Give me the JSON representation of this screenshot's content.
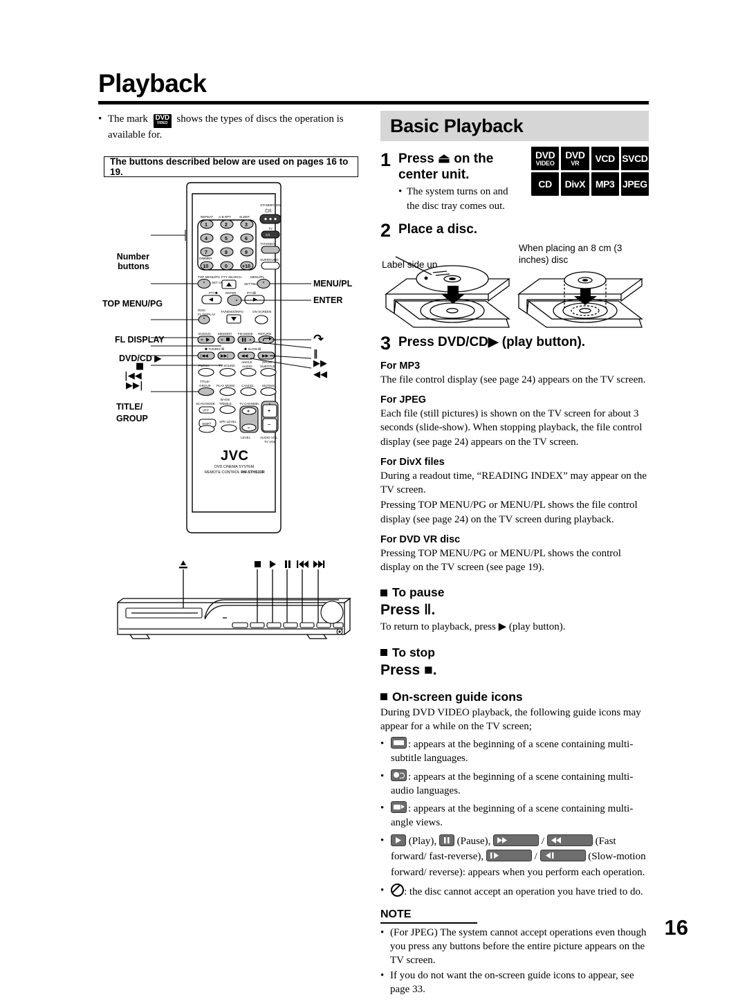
{
  "page": {
    "title": "Playback",
    "number": "16"
  },
  "left": {
    "mark_note_pre": "The mark",
    "mark_badge_line1": "DVD",
    "mark_badge_line2": "VIDEO",
    "mark_note_post": "shows the types of discs the operation is available for.",
    "buttons_note": "The buttons described below are used on pages 16 to 19.",
    "remote_labels_left": [
      "Number buttons",
      "TOP MENU/PG",
      "FL DISPLAY",
      "DVD/CD ▶",
      "■",
      "|◀◀",
      "▶▶|",
      "TITLE/ GROUP"
    ],
    "remote_labels_right": [
      "MENU/PL",
      "ENTER",
      "↷",
      "‖",
      "▶▶",
      "◀◀"
    ],
    "remote_keys": {
      "standby_label": "STANDBY/ON",
      "standby_sym": "⏻/I",
      "tv_label": "TV",
      "tv_sym": "⏻/I",
      "tv_video": "TV/VIDEO",
      "surround": "SURROUND",
      "num_row1": [
        "REPEAT",
        "A-B RPT",
        "SLEEP"
      ],
      "num_keys": [
        "1",
        "2",
        "3",
        "4",
        "5",
        "6",
        "7",
        "8",
        "9",
        "10",
        "0",
        "+10"
      ],
      "dimmer": "DIMMER",
      "top_menu_pg": "TOP MENU/PG",
      "set_up": "SET UP",
      "pty_search": "PTY SEARCH",
      "menu_pl": "MENU/PL",
      "setting": "SETTING",
      "pty_minus": "PTY",
      "enter": "ENTER",
      "pty_plus": "PTY",
      "rds_fl_display": "RDS/ FL DISPLAY",
      "ta_news_info": "TA/NEWS/INFO",
      "on_screen": "ON SCREEN",
      "dvd_cd": "DVD/CD",
      "memory": "MEMORY",
      "fm_mode": "FM MODE",
      "return": "RETURN",
      "tuning": "TUNING",
      "slow": "SLOW",
      "fm_am": "FM/AM",
      "tv_sound": "TV SOUND",
      "angle": "ANGLE",
      "audio": "AUDIO",
      "zoom": "ZOOM",
      "subtitle": "SUBTITLE",
      "title_group": "TITLE/ GROUP",
      "play_mode": "PLAY MODE",
      "cancel": "CANCEL",
      "muting": "MUTING",
      "scan_mode": "SCAN MODE",
      "vfp": "VFP",
      "bass_treble": "BASS/ TREBLE",
      "tv_channel": "TV CHANNEL",
      "shift": "SHIFT",
      "spk_level": "SPK-LEVEL",
      "level": "LEVEL",
      "audio_vol": "AUDIO VOL",
      "tv_vol": "TV VOL",
      "brand": "JVC",
      "brand_sub1": "DVD CINEMA SYSTEM",
      "brand_sub2": "REMOTE CONTROL",
      "model": "RM-STHS33R"
    },
    "center_unit_labels": [
      "▲",
      "■",
      "▶",
      "‖",
      "|◀◀",
      "▶▶|"
    ]
  },
  "right": {
    "section_title": "Basic Playback",
    "discs": [
      {
        "l1": "DVD",
        "l2": "VIDEO"
      },
      {
        "l1": "DVD",
        "l2": "VR"
      },
      {
        "l1": "VCD",
        "l2": ""
      },
      {
        "l1": "SVCD",
        "l2": ""
      },
      {
        "l1": "CD",
        "l2": ""
      },
      {
        "l1": "DivX",
        "l2": ""
      },
      {
        "l1": "MP3",
        "l2": ""
      },
      {
        "l1": "JPEG",
        "l2": ""
      }
    ],
    "step1": {
      "num": "1",
      "head": "Press ⏏ on the center unit.",
      "bullet": "The system turns on and the disc tray comes out."
    },
    "step2": {
      "num": "2",
      "head": "Place a disc.",
      "caption_left": "Label side up",
      "caption_right": "When placing an 8 cm (3 inches) disc"
    },
    "step3": {
      "num": "3",
      "head": "Press DVD/CD▶ (play button).",
      "blocks": [
        {
          "head": "For MP3",
          "body": "The file control display (see page 24) appears on the TV screen."
        },
        {
          "head": "For JPEG",
          "body": "Each file (still pictures) is shown on the TV screen for about 3 seconds (slide-show). When stopping playback, the file control display (see page 24) appears on the TV screen."
        },
        {
          "head": "For DivX files",
          "body": "During a readout time, “READING INDEX” may appear on the TV screen."
        },
        {
          "head": "",
          "body": "Pressing TOP MENU/PG or MENU/PL shows the file control display (see page 24) on the TV screen during playback."
        },
        {
          "head": "For DVD VR disc",
          "body": "Pressing TOP MENU/PG or MENU/PL shows the control display on the TV screen (see page 19)."
        }
      ]
    },
    "to_pause": {
      "head": "To pause",
      "press": "Press ‖.",
      "body": "To return to playback, press ▶ (play button)."
    },
    "to_stop": {
      "head": "To stop",
      "press": "Press ■."
    },
    "guide": {
      "head": "On-screen guide icons",
      "intro": "During DVD VIDEO playback, the following guide icons may appear for a while on the TV screen;",
      "items": [
        {
          "icon": "subtitle-icon",
          "text": ": appears at the beginning of a scene containing multi-subtitle languages."
        },
        {
          "icon": "audio-icon",
          "text": ": appears at the beginning of a scene containing multi-audio languages."
        },
        {
          "icon": "angle-icon",
          "text": ": appears at the beginning of a scene containing multi-angle views."
        }
      ],
      "transport_labels": {
        "play": "(Play),",
        "pause": "(Pause),",
        "slash": "/",
        "ff_fr": "(Fast forward/ fast-reverse),",
        "slow": "(Slow-motion forward/ reverse): appears when you perform each operation."
      },
      "no_op": ": the disc cannot accept an operation you have tried to do."
    },
    "note": {
      "head": "NOTE",
      "items": [
        "(For JPEG) The system cannot accept operations even though you press any buttons before the entire picture appears on the TV screen.",
        "If you do not want the on-screen guide icons to appear, see page 33."
      ]
    }
  }
}
